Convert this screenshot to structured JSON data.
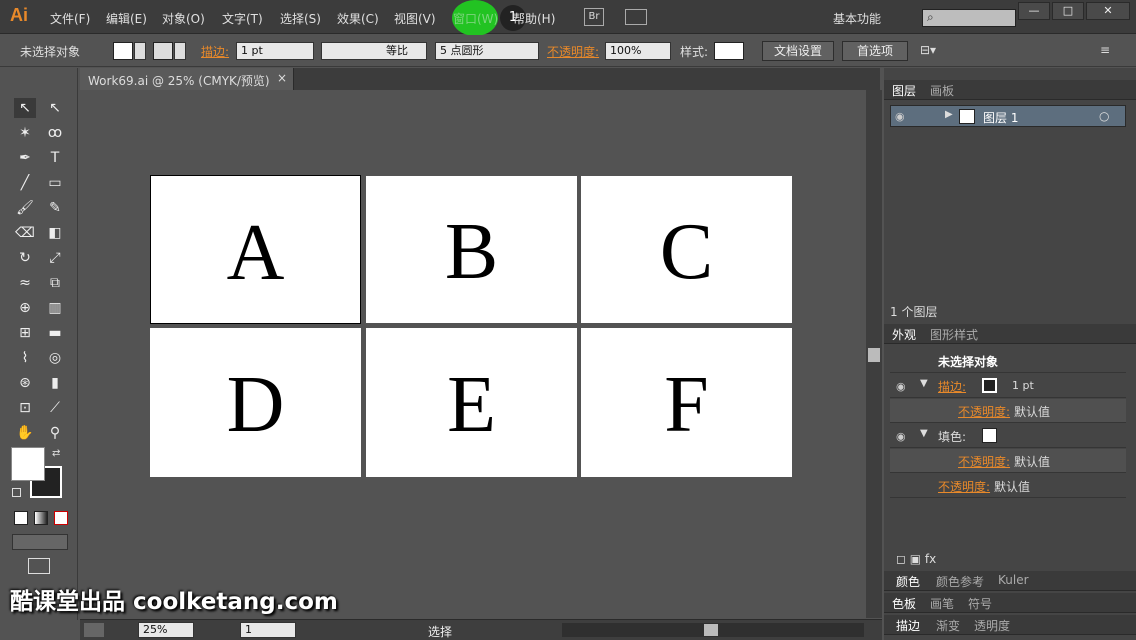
{
  "app": {
    "logo": "Ai"
  },
  "menu": [
    "文件(F)",
    "编辑(E)",
    "对象(O)",
    "文字(T)",
    "选择(S)",
    "效果(C)",
    "视图(V)",
    "窗口(W)",
    "帮助(H)"
  ],
  "bridge": "Br",
  "workspace": "基本功能",
  "window_buttons": [
    "—",
    "□",
    "✕"
  ],
  "control": {
    "selection": "未选择对象",
    "stroke_label": "描边:",
    "stroke_weight": "1 pt",
    "profile": "等比",
    "brush": "5 点圆形",
    "opacity_label": "不透明度:",
    "opacity": "100%",
    "style_label": "样式:",
    "doc_setup": "文档设置",
    "prefs": "首选项"
  },
  "document": {
    "tab": "Work69.ai @ 25% (CMYK/预览)",
    "close": "×"
  },
  "artboards": [
    "A",
    "B",
    "C",
    "D",
    "E",
    "F"
  ],
  "status": {
    "zoom": "25%",
    "page": "1",
    "mode": "选择"
  },
  "layers": {
    "tabs": [
      "图层",
      "画板"
    ],
    "layer_name": "图层 1",
    "count": "1 个图层"
  },
  "appearance": {
    "tabs": [
      "外观",
      "图形样式"
    ],
    "header": "未选择对象",
    "stroke_label": "描边:",
    "stroke_value": "1 pt",
    "opacity_label": "不透明度:",
    "opacity_value": "默认值",
    "fill_label": "填色:"
  },
  "bottom_tabs": [
    [
      "颜色",
      "颜色参考",
      "Kuler"
    ],
    [
      "色板",
      "画笔",
      "符号"
    ],
    [
      "描边",
      "渐变",
      "透明度"
    ]
  ],
  "watermark": "酷课堂出品 coolketang.com",
  "click_index": "1",
  "colors": {
    "accent": "#e8892a",
    "highlight": "#22c322"
  }
}
